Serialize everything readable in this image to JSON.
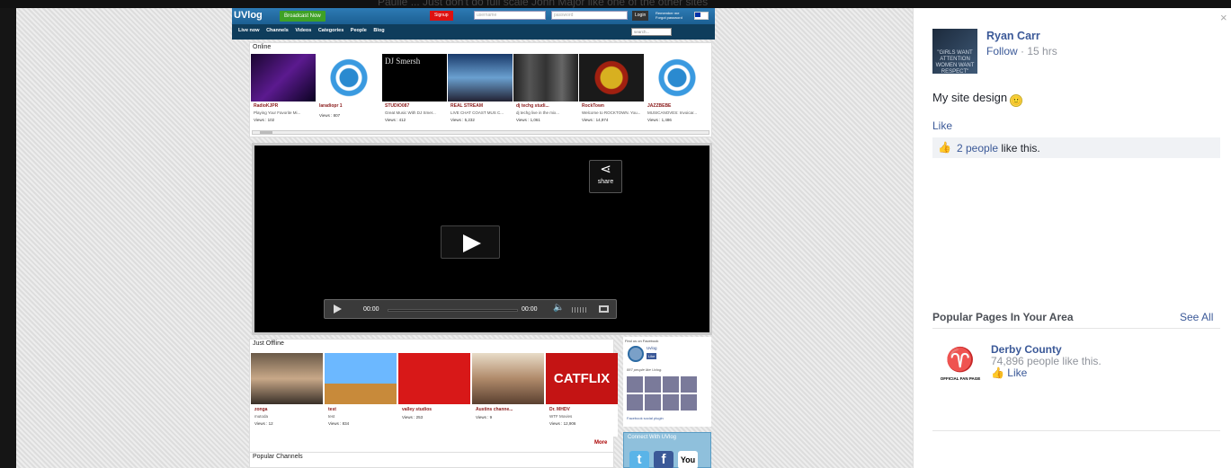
{
  "background_text": "Paulie ... Just don't do full scale John Major like one of the other sites",
  "uvlog": {
    "logo": "UVlog",
    "broadcast_label": "Broadcast Now",
    "signup_label": "Signup",
    "username_placeholder": "username",
    "password_placeholder": "password",
    "login_label": "Login",
    "remember_label": "Remember me",
    "forgot_label": "Forgot password",
    "nav": [
      "Live now",
      "Channels",
      "Videos",
      "Categories",
      "People",
      "Blog"
    ],
    "search_placeholder": "search...",
    "online": {
      "title": "Online",
      "items": [
        {
          "name": "RadioKJPR",
          "desc": "Playing Your Favorite Mi...",
          "views": "Views : 102"
        },
        {
          "name": "laradiopr 1",
          "desc": "",
          "views": "Views : 807"
        },
        {
          "name": "STUDIO087",
          "desc": "Great Music With DJ Smer...",
          "views": "Views : 412"
        },
        {
          "name": "REAL STREAM",
          "desc": "LIVE CHAT COAST MUS C...",
          "views": "Views : 5,232"
        },
        {
          "name": "dj techg studi...",
          "desc": "dj techg live in the mix...",
          "views": "Views : 1,061"
        },
        {
          "name": "RockTown",
          "desc": "Welcome to ROCKTOWN. You...",
          "views": "Views : 14,974"
        },
        {
          "name": "JAZZBEBE",
          "desc": "MUSICANOVES: Invoicar...",
          "views": "Views : 1,486"
        }
      ]
    },
    "player": {
      "share_label": "share",
      "time_current": "00:00",
      "time_total": "00:00"
    },
    "just_offline": {
      "title": "Just Offline",
      "items": [
        {
          "name": "zonga",
          "desc": "mutoda",
          "views": "Views : 12"
        },
        {
          "name": "test",
          "desc": "test",
          "views": "Views : 834"
        },
        {
          "name": "valley studios",
          "desc": "",
          "views": "Views : 253"
        },
        {
          "name": "Austins channe...",
          "desc": "",
          "views": "Views : 9"
        },
        {
          "name": "Dr. MHDV",
          "desc": "WTF Movies",
          "views": "Views : 12,906"
        }
      ],
      "more_label": "More"
    },
    "facebook_box": {
      "heading": "Find us on Facebook",
      "page_name": "Uvlog",
      "like_label": "Like",
      "people_like": "887 people like Uvlog.",
      "plugin_label": "Facebook social plugin"
    },
    "connect": {
      "heading": "Connect With UVlog",
      "youtube_label": "You"
    },
    "popular_channels_title": "Popular Channels",
    "catflix_text": "CATFLIX",
    "studio_text": "DJ Smersh"
  },
  "facebook": {
    "close_icon": "×",
    "avatar_text": "\"GIRLS WANT ATTENTION WOMEN WANT RESPECT\"",
    "user_name": "Ryan Carr",
    "follow_label": "Follow",
    "separator": " · ",
    "time": "15 hrs",
    "post_text": "My site design",
    "emoji": "🙂",
    "like_label": "Like",
    "like_count_link": "2 people",
    "like_count_suffix": " like this.",
    "popular_title": "Popular Pages In Your Area",
    "see_all": "See All",
    "page": {
      "name": "Derby County",
      "likes": "74,896 people like this.",
      "like_label": "Like",
      "logo_caption": "OFFICIAL FAN PAGE"
    }
  },
  "colors": {
    "fb_blue": "#3b5998",
    "uvlog_bar": "#2d7bb5",
    "uvlog_green": "#3ea126",
    "uvlog_red": "#d11111"
  }
}
